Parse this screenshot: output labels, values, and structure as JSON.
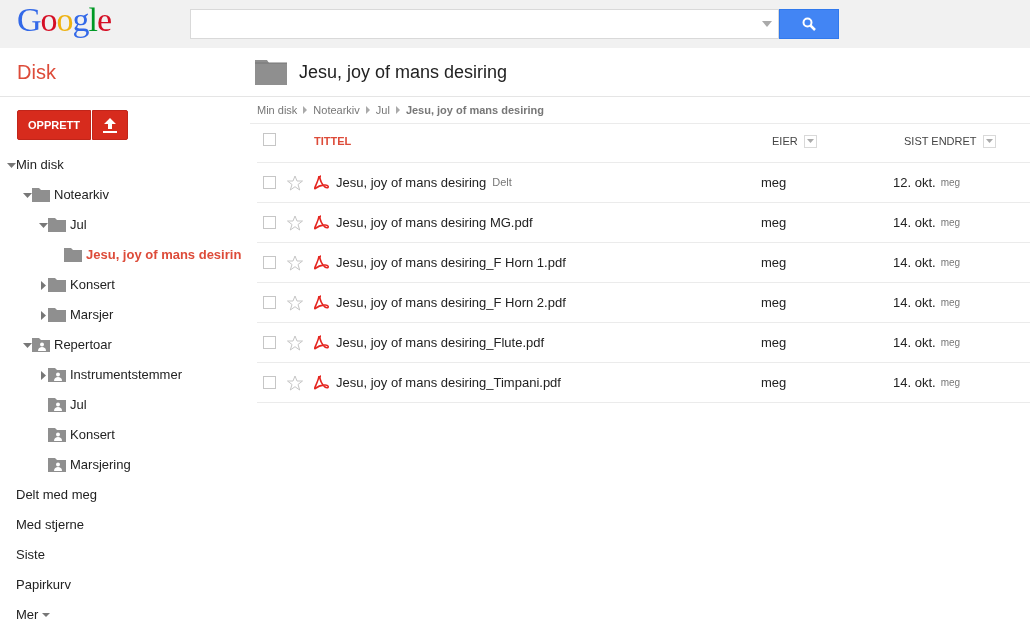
{
  "header": {
    "logo": "Google"
  },
  "app_title": "Disk",
  "folder_title": "Jesu, joy of mans desiring",
  "create_button": "OPPRETT",
  "tree": [
    {
      "label": "Min disk",
      "kind": "root",
      "expandable": true,
      "expanded": true,
      "selected": false,
      "children": [
        {
          "label": "Notearkiv",
          "kind": "folder",
          "expandable": true,
          "expanded": true,
          "selected": false,
          "children": [
            {
              "label": "Jul",
              "kind": "folder",
              "expandable": true,
              "expanded": true,
              "selected": false,
              "children": [
                {
                  "label": "Jesu, joy of mans desirin",
                  "kind": "folder",
                  "expandable": false,
                  "selected": true
                }
              ]
            },
            {
              "label": "Konsert",
              "kind": "folder",
              "expandable": true,
              "expanded": false,
              "selected": false
            },
            {
              "label": "Marsjer",
              "kind": "folder",
              "expandable": true,
              "expanded": false,
              "selected": false
            }
          ]
        },
        {
          "label": "Repertoar",
          "kind": "shared",
          "expandable": true,
          "expanded": true,
          "selected": false,
          "children": [
            {
              "label": "Instrumentstemmer",
              "kind": "shared",
              "expandable": true,
              "expanded": false,
              "selected": false
            },
            {
              "label": "Jul",
              "kind": "shared",
              "expandable": false,
              "selected": false
            },
            {
              "label": "Konsert",
              "kind": "shared",
              "expandable": false,
              "selected": false
            },
            {
              "label": "Marsjering",
              "kind": "shared",
              "expandable": false,
              "selected": false
            }
          ]
        }
      ]
    }
  ],
  "nav": [
    {
      "label": "Delt med meg",
      "kind": "link"
    },
    {
      "label": "Med stjerne",
      "kind": "link"
    },
    {
      "label": "Siste",
      "kind": "link"
    },
    {
      "label": "Papirkurv",
      "kind": "link"
    },
    {
      "label": "Mer",
      "kind": "menu"
    }
  ],
  "breadcrumbs": [
    {
      "label": "Min disk",
      "current": false
    },
    {
      "label": "Notearkiv",
      "current": false
    },
    {
      "label": "Jul",
      "current": false
    },
    {
      "label": "Jesu, joy of mans desiring",
      "current": true
    }
  ],
  "table": {
    "select_all": false,
    "columns": [
      {
        "label": "TITTEL",
        "sorted": true,
        "menu": false
      },
      {
        "label": "EIER",
        "sorted": false,
        "menu": true
      },
      {
        "label": "SIST ENDRET",
        "sorted": false,
        "menu": true
      }
    ],
    "rows": [
      {
        "checked": false,
        "starred": false,
        "title": "Jesu, joy of mans desiring",
        "tag": "Delt",
        "owner": "meg",
        "modified": "12. okt.",
        "modified_by": "meg"
      },
      {
        "checked": false,
        "starred": false,
        "title": "Jesu, joy of mans desiring MG.pdf",
        "owner": "meg",
        "modified": "14. okt.",
        "modified_by": "meg"
      },
      {
        "checked": false,
        "starred": false,
        "title": "Jesu, joy of mans desiring_F Horn 1.pdf",
        "owner": "meg",
        "modified": "14. okt.",
        "modified_by": "meg"
      },
      {
        "checked": false,
        "starred": false,
        "title": "Jesu, joy of mans desiring_F Horn 2.pdf",
        "owner": "meg",
        "modified": "14. okt.",
        "modified_by": "meg"
      },
      {
        "checked": false,
        "starred": false,
        "title": "Jesu, joy of mans desiring_Flute.pdf",
        "owner": "meg",
        "modified": "14. okt.",
        "modified_by": "meg"
      },
      {
        "checked": false,
        "starred": false,
        "title": "Jesu, joy of mans desiring_Timpani.pdf",
        "owner": "meg",
        "modified": "14. okt.",
        "modified_by": "meg"
      }
    ]
  }
}
